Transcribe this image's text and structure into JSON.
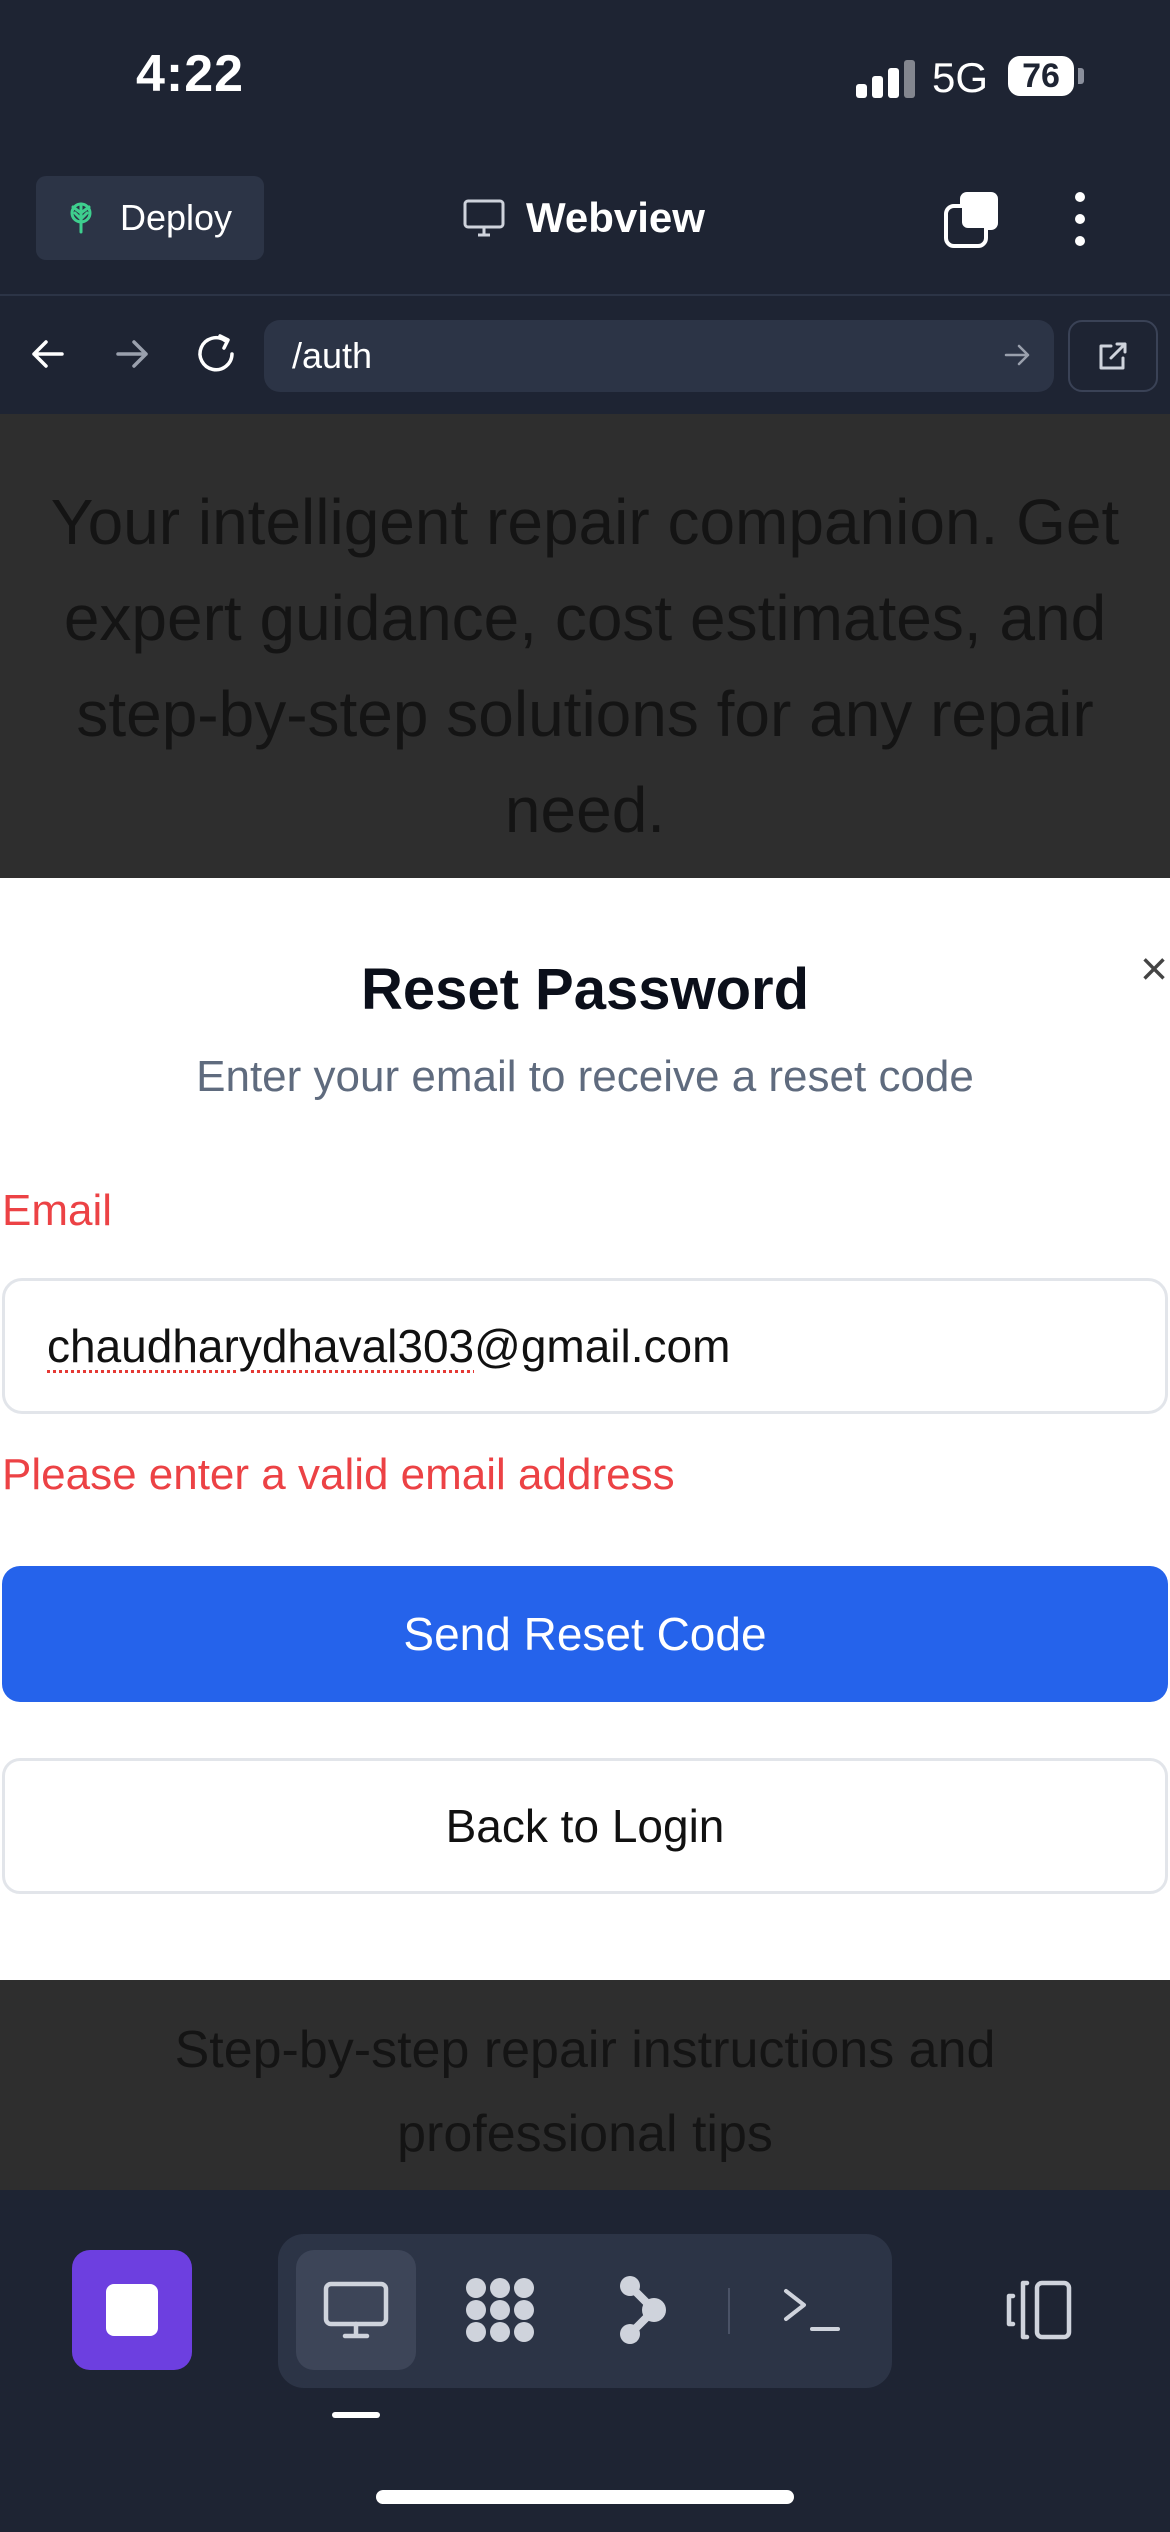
{
  "status_bar": {
    "time": "4:22",
    "network": "5G",
    "battery": "76"
  },
  "top_bar": {
    "deploy_label": "Deploy",
    "title": "Webview"
  },
  "url_bar": {
    "url": "/auth"
  },
  "page": {
    "hero_text": "Your intelligent repair companion. Get expert guidance, cost estimates, and step-by-step solutions for any repair need.",
    "feature_text": "Step-by-step repair instructions and professional tips"
  },
  "modal": {
    "close_glyph": "×",
    "title": "Reset Password",
    "subtitle": "Enter your email to receive a reset code",
    "email_label": "Email",
    "email_value_misspelled": "chaudharydhaval303",
    "email_value_rest": "@gmail.com",
    "error_text": "Please enter a valid email address",
    "send_button": "Send Reset Code",
    "back_button": "Back to Login"
  },
  "colors": {
    "app_bg": "#1e2433",
    "accent_blue": "#2563eb",
    "error_red": "#ec4245",
    "stop_purple": "#6d3fe0"
  },
  "icons": [
    "deploy-icon",
    "monitor-icon",
    "tabs-icon",
    "more-vertical-icon",
    "arrow-left-icon",
    "arrow-right-icon",
    "reload-icon",
    "external-link-icon",
    "stop-icon",
    "grid-icon",
    "git-branch-icon",
    "terminal-icon",
    "layout-icon"
  ]
}
